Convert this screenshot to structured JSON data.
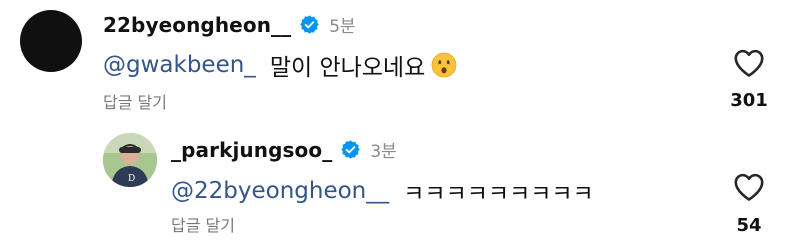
{
  "comments": [
    {
      "username": "22byeongheon__",
      "verified": true,
      "time": "5분",
      "mention": "@gwakbeen_",
      "text": "말이 안나오네요",
      "emoji": "astonished-face",
      "reply_label": "답글 달기",
      "likes": "301"
    },
    {
      "username": "_parkjungsoo_",
      "verified": true,
      "time": "3분",
      "mention": "@22byeongheon__",
      "text": "ㅋㅋㅋㅋㅋㅋㅋㅋㅋ",
      "reply_label": "답글 달기",
      "likes": "54"
    }
  ],
  "colors": {
    "verified_badge": "#0095f6",
    "mention": "#35558a",
    "muted_text": "#8a8a8a"
  }
}
